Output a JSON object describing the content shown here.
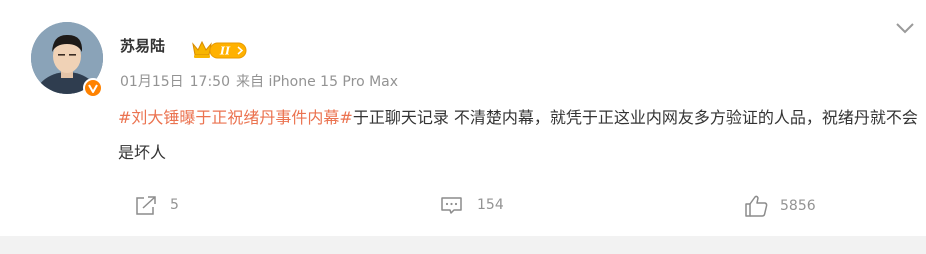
{
  "post": {
    "username": "苏易陆",
    "vip_level": "II",
    "date": "01月15日",
    "time": "17:50",
    "source": "来自 iPhone 15 Pro Max",
    "topic": "#刘大锤曝于正祝绪丹事件内幕#",
    "text": "于正聊天记录 不清楚内幕，就凭于正这业内网友多方验证的人品，祝绪丹就不会是坏人"
  },
  "actions": {
    "repost_count": "5",
    "comment_count": "154",
    "like_count": "5856"
  },
  "colors": {
    "topic": "#eb7350",
    "verify_badge": "#ff8200",
    "vip_badge": "#ffb100",
    "text": "#333333",
    "muted": "#939393"
  },
  "icons": [
    "verified-badge-icon",
    "vip-crown-icon",
    "chevron-down-icon",
    "repost-icon",
    "comment-icon",
    "like-icon"
  ]
}
